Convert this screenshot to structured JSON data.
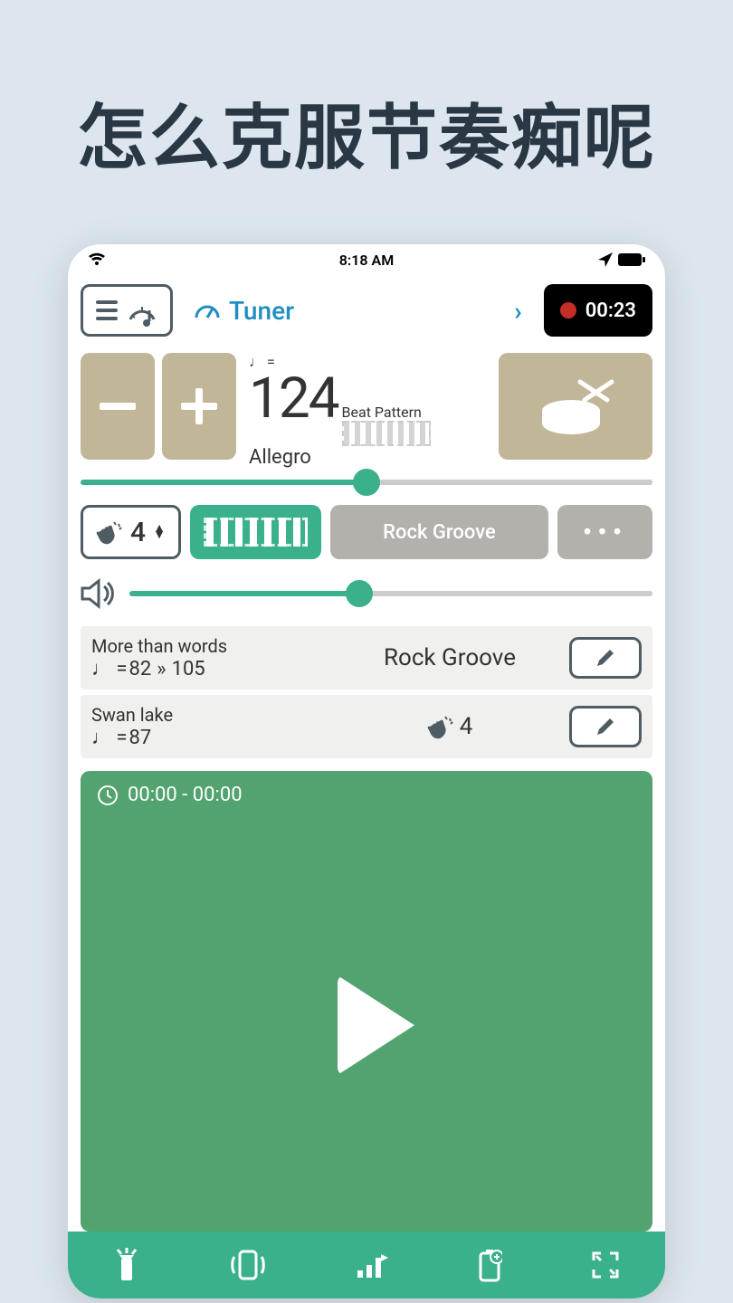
{
  "headline": "怎么克服节奏痴呢",
  "status": {
    "time": "8:18 AM"
  },
  "toolbar": {
    "tuner_label": "Tuner",
    "rec_time": "00:23"
  },
  "bpm": {
    "value": "124",
    "tempo_label": "Allegro",
    "beat_pattern_label": "Beat Pattern",
    "note_equals": "♩ ="
  },
  "controls": {
    "time_sig": "4",
    "groove_label": "Rock Groove"
  },
  "songs": [
    {
      "name": "More than words",
      "bpm_prefix": "♩ =",
      "bpm_value": "82",
      "bpm_target": "105",
      "center_text": "Rock Groove"
    },
    {
      "name": "Swan lake",
      "bpm_prefix": "♩ =",
      "bpm_value": "87",
      "center_icon": "clap",
      "center_value": "4"
    }
  ],
  "play": {
    "time_range": "00:00 - 00:00"
  },
  "sliders": {
    "tempo_pos_pct": 50,
    "volume_pos_pct": 44
  }
}
